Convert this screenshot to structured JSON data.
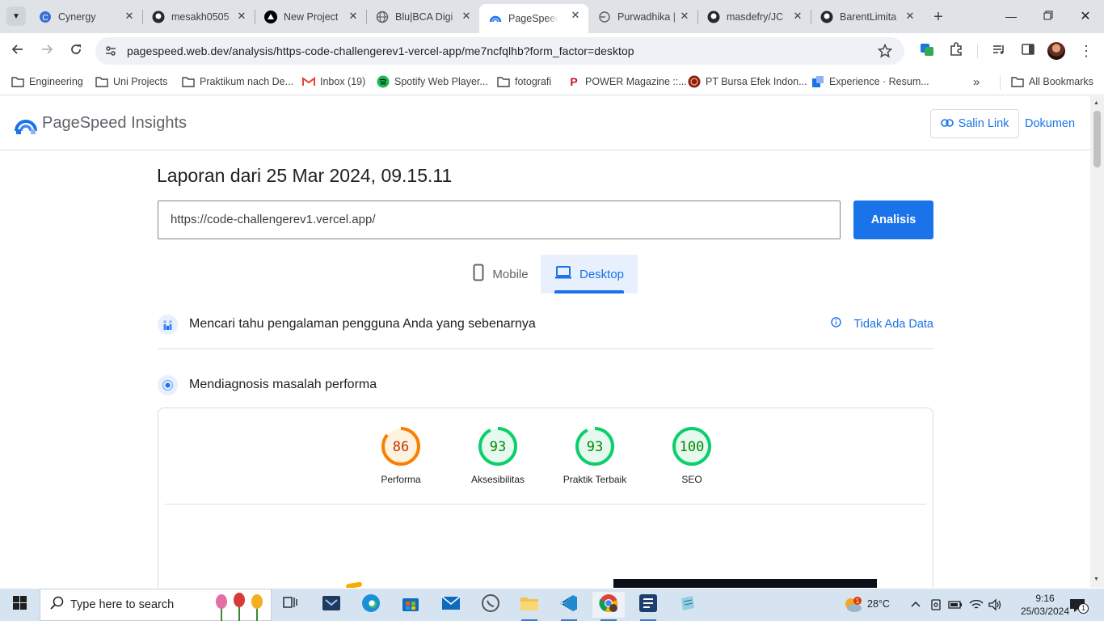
{
  "browser": {
    "tabs": [
      {
        "title": "Cynergy",
        "icon": "cynergy-icon",
        "active": false
      },
      {
        "title": "mesakh0505",
        "icon": "github-icon",
        "active": false
      },
      {
        "title": "New Project",
        "icon": "vercel-icon",
        "active": false
      },
      {
        "title": "Blu|BCA Digi",
        "icon": "globe-icon",
        "active": false
      },
      {
        "title": "PageSpeed I",
        "icon": "pagespeed-icon",
        "active": true
      },
      {
        "title": "Purwadhika |",
        "icon": "purwadhika-icon",
        "active": false
      },
      {
        "title": "masdefry/JC",
        "icon": "github-icon",
        "active": false
      },
      {
        "title": "BarentLimita",
        "icon": "github-icon",
        "active": false
      }
    ],
    "new_tab_label": "+",
    "url": "pagespeed.web.dev/analysis/https-code-challengerev1-vercel-app/me7ncfqlhb?form_factor=desktop",
    "bookmarks": [
      {
        "label": "Engineering",
        "icon": "folder-icon"
      },
      {
        "label": "Uni Projects",
        "icon": "folder-icon"
      },
      {
        "label": "Praktikum nach De...",
        "icon": "folder-icon"
      },
      {
        "label": "Inbox (19)",
        "icon": "gmail-icon"
      },
      {
        "label": "Spotify Web Player...",
        "icon": "spotify-icon"
      },
      {
        "label": "fotografi",
        "icon": "folder-icon"
      },
      {
        "label": "POWER Magazine ::...",
        "icon": "power-icon"
      },
      {
        "label": "PT Bursa Efek Indon...",
        "icon": "idx-icon"
      },
      {
        "label": "Experience · Resum...",
        "icon": "resume-icon"
      }
    ],
    "all_bookmarks": "All Bookmarks",
    "accent": "#1a73e8"
  },
  "psi": {
    "brand": "PageSpeed Insights",
    "copy_link": "Salin Link",
    "docs": "Dokumen",
    "report_title": "Laporan dari 25 Mar 2024, 09.15.11",
    "input_url": "https://code-challengerev1.vercel.app/",
    "analyze": "Analisis",
    "tabs": {
      "mobile": "Mobile",
      "desktop": "Desktop",
      "selected": "Desktop"
    },
    "field_section": {
      "title": "Mencari tahu pengalaman pengguna Anda yang sebenarnya",
      "status": "Tidak Ada Data"
    },
    "lab_section": {
      "title": "Mendiagnosis masalah performa"
    },
    "scores": [
      {
        "label": "Performa",
        "score": 86,
        "color": "#fa7f00",
        "track": "#fff3e0"
      },
      {
        "label": "Aksesibilitas",
        "score": 93,
        "color": "#0cce6b",
        "track": "#e6f9ef"
      },
      {
        "label": "Praktik Terbaik",
        "score": 93,
        "color": "#0cce6b",
        "track": "#e6f9ef"
      },
      {
        "label": "SEO",
        "score": 100,
        "color": "#0cce6b",
        "track": "#e6f9ef"
      }
    ]
  },
  "taskbar": {
    "search_placeholder": "Type here to search",
    "weather": "28°C",
    "time": "9:16",
    "date": "25/03/2024",
    "notification_count": "1"
  }
}
